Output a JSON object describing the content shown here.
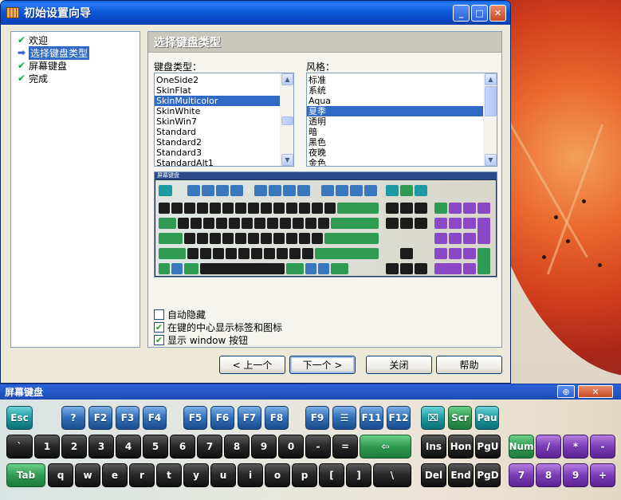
{
  "window": {
    "title": "初始设置向导",
    "controls": {
      "minimize": "_",
      "maximize": "□",
      "close": "✕"
    }
  },
  "steps": [
    {
      "label": "欢迎",
      "icon": "check-icon",
      "active": false
    },
    {
      "label": "选择键盘类型",
      "icon": "arrow-right-icon",
      "active": true
    },
    {
      "label": "屏幕键盘",
      "icon": "check-icon",
      "active": false
    },
    {
      "label": "完成",
      "icon": "check-icon",
      "active": false
    }
  ],
  "panel": {
    "title": "选择键盘类型",
    "type_label": "键盘类型：",
    "style_label": "风格：",
    "type_items": [
      "OneSide2",
      "SkinFlat",
      "SkinMulticolor",
      "SkinWhite",
      "SkinWin7",
      "Standard",
      "Standard2",
      "Standard3",
      "StandardAlt1"
    ],
    "type_selected": "SkinMulticolor",
    "style_items": [
      "标准",
      "系统",
      "Aqua",
      "夏季",
      "透明",
      "暗",
      "黑色",
      "夜晚",
      "金色"
    ],
    "style_selected": "夏季",
    "preview_title": "屏幕键盘",
    "options": [
      {
        "label": "自动隐藏",
        "checked": false
      },
      {
        "label": "在键的中心显示标签和图标",
        "checked": true
      },
      {
        "label": "显示 window 按钮",
        "checked": true
      }
    ]
  },
  "buttons": {
    "back": "< 上一个",
    "next": "下一个 >",
    "close": "关闭",
    "help": "帮助"
  },
  "osk": {
    "title": "屏幕键盘",
    "controls": {
      "pin": "⊕",
      "close": "✕"
    },
    "rows": [
      [
        "Esc",
        "?",
        "F2",
        "F3",
        "F4",
        "F5",
        "F6",
        "F7",
        "F8",
        "F9",
        "☰",
        "F11",
        "F12",
        "⌧",
        "Scr",
        "Pau"
      ],
      [
        "`",
        "1",
        "2",
        "3",
        "4",
        "5",
        "6",
        "7",
        "8",
        "9",
        "0",
        "-",
        "=",
        "⇦",
        "Ins",
        "Hon",
        "PgU",
        "Num",
        "/",
        "*",
        "-"
      ],
      [
        "Tab",
        "q",
        "w",
        "e",
        "r",
        "t",
        "y",
        "u",
        "i",
        "o",
        "p",
        "[",
        "]",
        "\\",
        "Del",
        "End",
        "PgD",
        "7",
        "8",
        "9",
        "+"
      ]
    ]
  },
  "colors": {
    "title_blue": "#0a58d8",
    "selection": "#316ac5",
    "key_black": "#1a1a1a",
    "key_green": "#2f9a52",
    "key_blue": "#2f6fb8",
    "key_teal": "#1c9aa2",
    "key_purple": "#7a3cb8"
  }
}
